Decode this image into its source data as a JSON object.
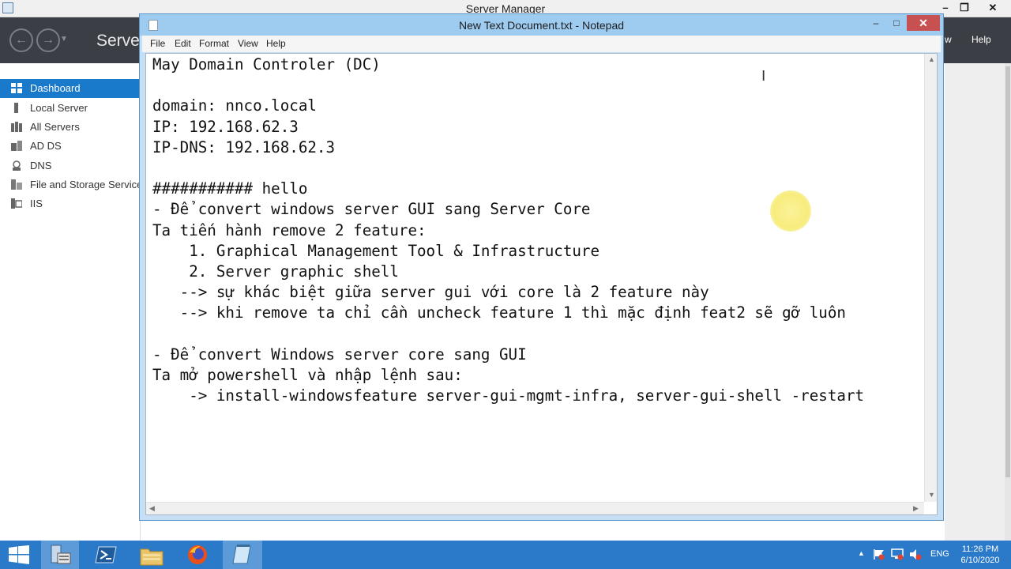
{
  "server_manager": {
    "title": "Server Manager",
    "brand": "Serve",
    "window_controls": {
      "minimize": "–",
      "restore": "❐",
      "close": "✕"
    },
    "menu": {
      "view": "w",
      "help": "Help"
    },
    "sidebar": [
      {
        "label": "Dashboard",
        "icon": "dashboard-icon",
        "active": true
      },
      {
        "label": "Local Server",
        "icon": "local-server-icon"
      },
      {
        "label": "All Servers",
        "icon": "all-servers-icon"
      },
      {
        "label": "AD DS",
        "icon": "ad-ds-icon"
      },
      {
        "label": "DNS",
        "icon": "dns-icon"
      },
      {
        "label": "File and Storage Service",
        "icon": "file-storage-icon"
      },
      {
        "label": "IIS",
        "icon": "iis-icon"
      }
    ]
  },
  "notepad": {
    "title": "New Text Document.txt - Notepad",
    "window_controls": {
      "minimize": "–",
      "maximize": "□",
      "close": "✕"
    },
    "menu": [
      "File",
      "Edit",
      "Format",
      "View",
      "Help"
    ],
    "content": "May Domain Controler (DC)\n\ndomain: nnco.local\nIP: 192.168.62.3\nIP-DNS: 192.168.62.3\n\n########### hello\n- Để convert windows server GUI sang Server Core\nTa tiến hành remove 2 feature:\n    1. Graphical Management Tool & Infrastructure\n    2. Server graphic shell\n   --> sự khác biệt giữa server gui với core là 2 feature này\n   --> khi remove ta chỉ cần uncheck feature 1 thì mặc định feat2 sẽ gỡ luôn\n\n- Để convert Windows server core sang GUI\nTa mở powershell và nhập lệnh sau:\n    -> install-windowsfeature server-gui-mgmt-infra, server-gui-shell -restart"
  },
  "taskbar": {
    "apps": [
      "start-icon",
      "server-manager-icon",
      "powershell-icon",
      "file-explorer-icon",
      "firefox-icon",
      "notepad-icon"
    ],
    "language": "ENG",
    "time": "11:26 PM",
    "date": "6/10/2020"
  },
  "colors": {
    "sm_header": "#3b3f45",
    "sidebar_active": "#1979ca",
    "notepad_frame": "#9ecbf0",
    "close_button": "#c75050",
    "taskbar": "#2b7ac9"
  }
}
